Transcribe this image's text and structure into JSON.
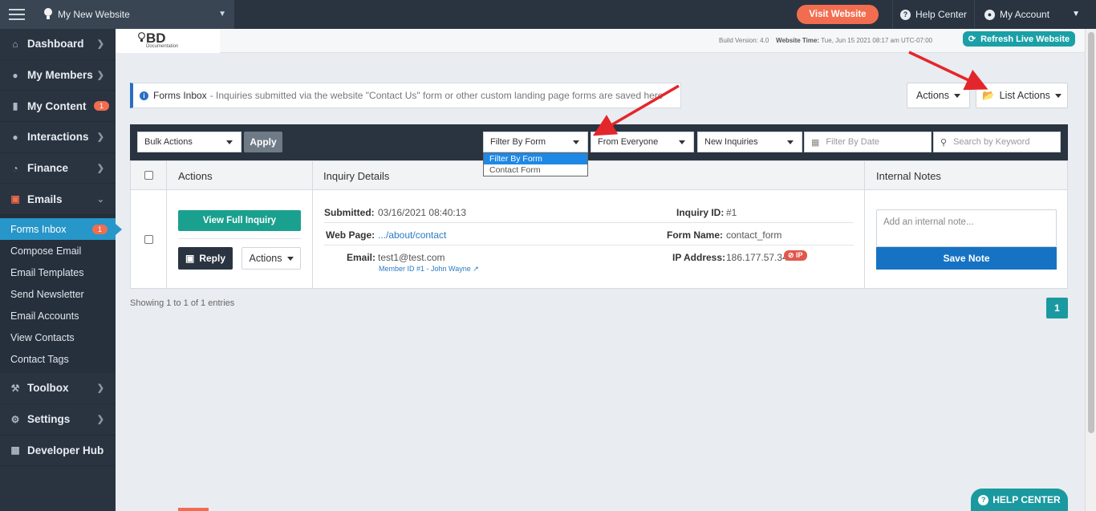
{
  "topbar": {
    "site_name": "My New Website",
    "visit_label": "Visit Website",
    "help_label": "Help Center",
    "account_label": "My Account"
  },
  "sidebar": {
    "items": [
      {
        "label": "Dashboard",
        "icon": "home-icon"
      },
      {
        "label": "My Members",
        "icon": "users-icon"
      },
      {
        "label": "My Content",
        "icon": "folder-icon",
        "badge": "1"
      },
      {
        "label": "Interactions",
        "icon": "comments-icon"
      },
      {
        "label": "Finance",
        "icon": "pie-chart-icon"
      },
      {
        "label": "Emails",
        "icon": "inbox-icon"
      }
    ],
    "email_sub": [
      {
        "label": "Forms Inbox",
        "badge": "1"
      },
      {
        "label": "Compose Email"
      },
      {
        "label": "Email Templates"
      },
      {
        "label": "Send Newsletter"
      },
      {
        "label": "Email Accounts"
      },
      {
        "label": "View Contacts"
      },
      {
        "label": "Contact Tags"
      }
    ],
    "bottom_items": [
      {
        "label": "Toolbox",
        "icon": "wrench-icon"
      },
      {
        "label": "Settings",
        "icon": "gear-icon"
      },
      {
        "label": "Developer Hub",
        "icon": "grid-icon"
      }
    ]
  },
  "subheader": {
    "logo_text": "BD",
    "logo_sub": "Documentation",
    "build_label": "Build Version:",
    "build_value": "4.0",
    "time_label": "Website Time:",
    "time_value": "Tue, Jun 15 2021 08:17 am UTC-07:00",
    "refresh_label": "Refresh Live Website"
  },
  "info_bar": {
    "title": "Forms Inbox",
    "text": "- Inquiries submitted via the website \"Contact Us\" form or other custom landing page forms are saved here"
  },
  "actions_label": "Actions",
  "list_actions_label": "List Actions",
  "filters": {
    "bulk_actions": "Bulk Actions",
    "apply": "Apply",
    "filter_by_form": "Filter By Form",
    "from_everyone": "From Everyone",
    "new_inquiries": "New Inquiries",
    "date_placeholder": "Filter By Date",
    "search_placeholder": "Search by Keyword",
    "form_options": [
      "Filter By Form",
      "Contact Form"
    ]
  },
  "table": {
    "headers": {
      "actions": "Actions",
      "details": "Inquiry Details",
      "notes": "Internal Notes"
    },
    "row": {
      "view_full": "View Full Inquiry",
      "reply": "Reply",
      "actions": "Actions",
      "submitted_label": "Submitted:",
      "submitted_value": "03/16/2021 08:40:13",
      "webpage_label": "Web Page:",
      "webpage_value": ".../about/contact",
      "email_label": "Email:",
      "email_value": "test1@test.com",
      "member_link": "Member ID #1 - John Wayne",
      "inquiry_id_label": "Inquiry ID:",
      "inquiry_id_value": "#1",
      "form_name_label": "Form Name:",
      "form_name_value": "contact_form",
      "ip_label": "IP Address:",
      "ip_value": "186.177.57.34",
      "ip_badge": "IP",
      "note_placeholder": "Add an internal note...",
      "save_note": "Save Note"
    }
  },
  "showing_text": "Showing 1 to 1 of 1 entries",
  "page_number": "1",
  "help_float": "HELP CENTER",
  "colors": {
    "dark": "#2a3441",
    "accent_orange": "#f26d4f",
    "teal": "#1aa0a6",
    "active_blue": "#2796c9",
    "arrow_red": "#e3262b"
  }
}
